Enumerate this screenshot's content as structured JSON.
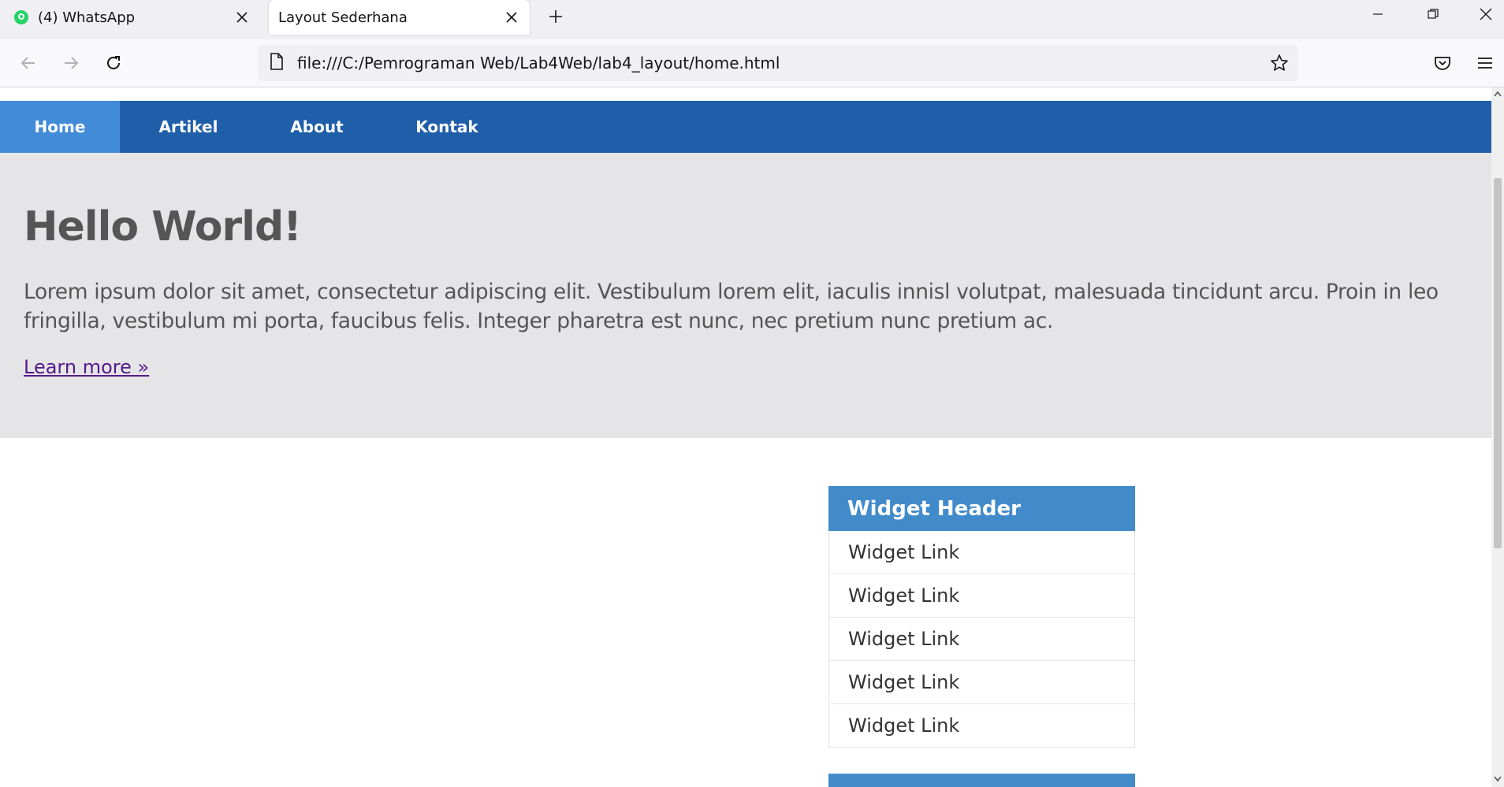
{
  "browser": {
    "tabs": [
      {
        "title": "(4) WhatsApp",
        "active": false,
        "favicon": "whatsapp-icon"
      },
      {
        "title": "Layout Sederhana",
        "active": true
      }
    ],
    "url": "file:///C:/Pemrograman Web/Lab4Web/lab4_layout/home.html"
  },
  "site": {
    "nav": [
      {
        "label": "Home",
        "active": true
      },
      {
        "label": "Artikel",
        "active": false
      },
      {
        "label": "About",
        "active": false
      },
      {
        "label": "Kontak",
        "active": false
      }
    ],
    "hero": {
      "title": "Hello World!",
      "text": "Lorem ipsum dolor sit amet, consectetur adipiscing elit. Vestibulum lorem elit, iaculis innisl volutpat, malesuada tincidunt arcu. Proin in leo fringilla, vestibulum mi porta, faucibus felis. Integer pharetra est nunc, nec pretium nunc pretium ac.",
      "link": "Learn more »"
    },
    "widget": {
      "header": "Widget Header",
      "links": [
        "Widget Link",
        "Widget Link",
        "Widget Link",
        "Widget Link",
        "Widget Link"
      ]
    }
  },
  "colors": {
    "nav_bg": "#1f5faa",
    "nav_active": "#428bd8",
    "hero_bg": "#e5e5e7",
    "widget_header": "#428bca"
  }
}
